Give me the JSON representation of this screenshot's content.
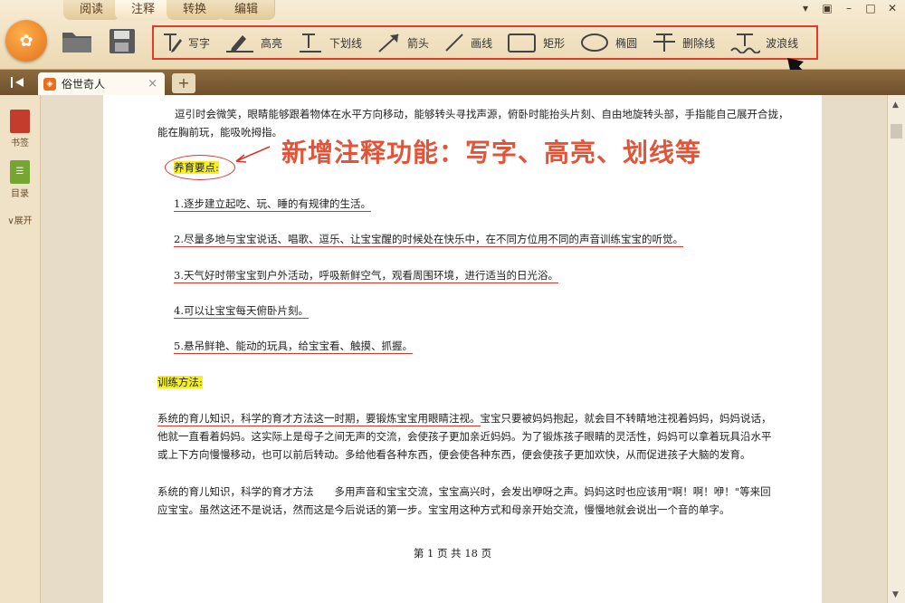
{
  "menu": {
    "tabs": [
      "阅读",
      "注释",
      "转换",
      "编辑"
    ],
    "active": 1
  },
  "window": {
    "controls": [
      "▾",
      "👕",
      "–",
      "□",
      "✕"
    ]
  },
  "toolbar": {
    "tools": [
      {
        "label": "写字",
        "icon": "write-icon"
      },
      {
        "label": "高亮",
        "icon": "highlight-icon"
      },
      {
        "label": "下划线",
        "icon": "underline-icon"
      },
      {
        "label": "箭头",
        "icon": "arrow-icon"
      },
      {
        "label": "画线",
        "icon": "line-icon"
      },
      {
        "label": "矩形",
        "icon": "rectangle-icon"
      },
      {
        "label": "椭圆",
        "icon": "ellipse-icon"
      },
      {
        "label": "删除线",
        "icon": "strikethrough-icon"
      },
      {
        "label": "波浪线",
        "icon": "wavy-line-icon"
      }
    ],
    "highlight_color": "#e03b2e"
  },
  "tabbar": {
    "doc_title": "俗世奇人",
    "close": "×",
    "new_tab": "+"
  },
  "sidebar": {
    "bookmark": "书签",
    "toc": "目录",
    "expand": "展开"
  },
  "document": {
    "intro_line1": "逗引时会微笑，眼睛能够跟着物体在水平方向移动，能够转头寻找声源，俯卧时能抬头片刻、自由地旋转头部，手指能自己展开合拢，",
    "intro_line2": "能在胸前玩，能吸吮拇指。",
    "section1": "养育要点:",
    "annotation_title": "新增注释功能：写字、高亮、划线等",
    "items": [
      "1.逐步建立起吃、玩、睡的有规律的生活。",
      "2.尽量多地与宝宝说话、唱歌、逗乐、让宝宝醒的时候处在快乐中，在不同方位用不同的声音训练宝宝的听觉。",
      "3.天气好时带宝宝到户外活动，呼吸新鲜空气，观看周围环境，进行适当的日光浴。",
      "4.可以让宝宝每天俯卧片刻。",
      "5.悬吊鲜艳、能动的玩具，给宝宝看、触摸、抓握。"
    ],
    "section2": "训练方法:",
    "para1_line1_ul": "系统的育儿知识，科学的育才方法这一时期，要锻炼宝宝用眼睛注视。",
    "para1_line1_rest": "宝宝只要被妈妈抱起，就会目不转睛地注视着妈妈，妈妈说话，",
    "para1_line2": "他就一直看着妈妈。这实际上是母子之间无声的交流，会使孩子更加亲近妈妈。为了锻炼孩子眼睛的灵活性，妈妈可以拿着玩具沿水平",
    "para1_line3": "或上下方向慢慢移动，也可以前后转动。多给他看各种东西，便会使各种东西，便会使孩子更加欢快，从而促进孩子大脑的发育。",
    "para2_line1": "系统的育儿知识，科学的育才方法　　多用声音和宝宝交流，宝宝高兴时，会发出咿呀之声。妈妈这时也应该用\"啊！啊！咿！\"等来回",
    "para2_line2": "应宝宝。虽然这还不是说话，然而这是今后说话的第一步。宝宝用这种方式和母亲开始交流，慢慢地就会说出一个音的单字。",
    "page_indicator": "第 1 页 共 18 页"
  }
}
